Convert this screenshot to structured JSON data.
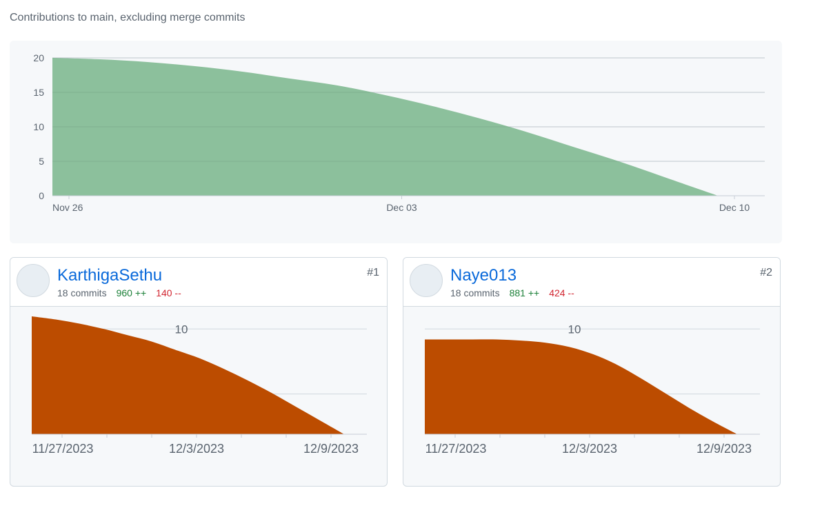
{
  "header": {
    "subtitle": "Contributions to main, excluding merge commits"
  },
  "colors": {
    "main_area": "#8cc09c",
    "contributor_area": "#bc4c00",
    "grid": "#d0d7de",
    "tick_text": "#59636e"
  },
  "chart_data": [
    {
      "type": "area",
      "title": "",
      "x_ticks": [
        "Nov 26",
        "Dec 03",
        "Dec 10"
      ],
      "y_ticks": [
        0,
        5,
        10,
        15,
        20
      ],
      "ylim": [
        0,
        20
      ],
      "grid": true,
      "x": [
        "Nov 26",
        "Nov 27",
        "Nov 28",
        "Nov 29",
        "Nov 30",
        "Dec 01",
        "Dec 02",
        "Dec 03",
        "Dec 04",
        "Dec 05",
        "Dec 06",
        "Dec 07",
        "Dec 08",
        "Dec 09",
        "Dec 10"
      ],
      "values": [
        20,
        19.8,
        19.4,
        18.8,
        18,
        17,
        16,
        14.6,
        13,
        11.2,
        9.2,
        7,
        4.8,
        2.4,
        0
      ]
    },
    {
      "type": "area",
      "contributor": "KarthigaSethu",
      "x_ticks": [
        "11/27/2023",
        "12/3/2023",
        "12/9/2023"
      ],
      "y_ticks": [
        10
      ],
      "ylim": [
        0,
        11
      ],
      "grid": true,
      "x": [
        "11/26/2023",
        "11/27/2023",
        "11/28/2023",
        "11/29/2023",
        "11/30/2023",
        "12/1/2023",
        "12/2/2023",
        "12/3/2023",
        "12/4/2023",
        "12/5/2023",
        "12/6/2023",
        "12/7/2023",
        "12/8/2023",
        "12/9/2023"
      ],
      "values": [
        11.2,
        10.9,
        10.5,
        10,
        9.4,
        8.8,
        8,
        7.2,
        6.2,
        5.1,
        3.9,
        2.6,
        1.3,
        0
      ]
    },
    {
      "type": "area",
      "contributor": "Naye013",
      "x_ticks": [
        "11/27/2023",
        "12/3/2023",
        "12/9/2023"
      ],
      "y_ticks": [
        10
      ],
      "ylim": [
        0,
        11
      ],
      "grid": true,
      "x": [
        "11/26/2023",
        "11/27/2023",
        "11/28/2023",
        "11/29/2023",
        "11/30/2023",
        "12/1/2023",
        "12/2/2023",
        "12/3/2023",
        "12/4/2023",
        "12/5/2023",
        "12/6/2023",
        "12/7/2023",
        "12/8/2023",
        "12/9/2023"
      ],
      "values": [
        9,
        9,
        9,
        9,
        8.9,
        8.7,
        8.3,
        7.6,
        6.6,
        5.3,
        3.9,
        2.5,
        1.2,
        0
      ]
    }
  ],
  "contributors": [
    {
      "username": "KarthigaSethu",
      "commits": "18 commits",
      "additions": "960 ++",
      "deletions": "140 --",
      "rank": "#1"
    },
    {
      "username": "Naye013",
      "commits": "18 commits",
      "additions": "881 ++",
      "deletions": "424 --",
      "rank": "#2"
    }
  ]
}
